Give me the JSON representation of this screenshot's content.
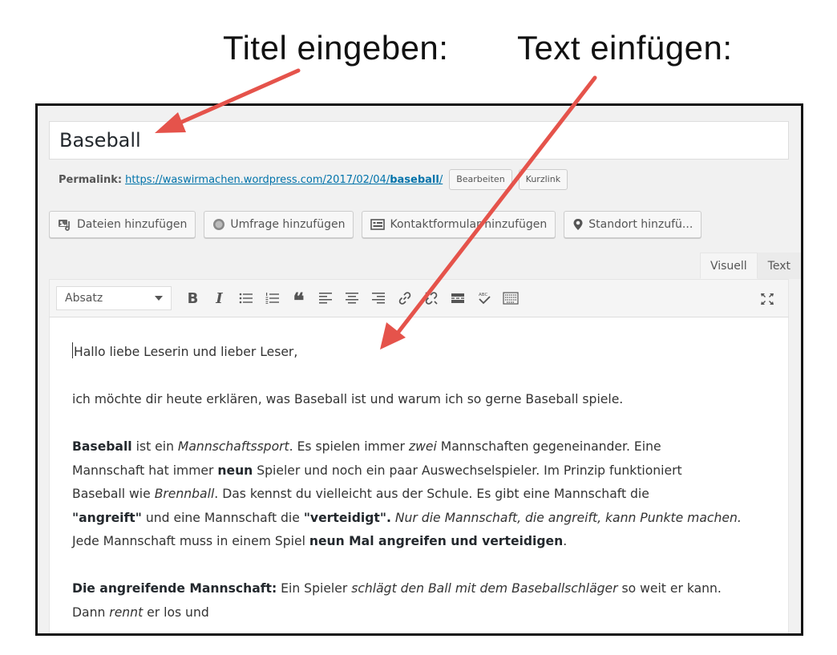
{
  "annotations": {
    "title_hint": "Titel eingeben:",
    "text_hint": "Text einfügen:",
    "arrow_color": "#e5534b"
  },
  "editor": {
    "title_value": "Baseball",
    "permalink": {
      "label": "Permalink:",
      "url_prefix": "https://waswirmachen.wordpress.com/2017/02/04/",
      "url_slug": "baseball",
      "url_suffix": "/",
      "edit_button": "Bearbeiten",
      "shortlink_button": "Kurzlink"
    },
    "media_buttons": {
      "add_files": "Dateien hinzufügen",
      "add_poll": "Umfrage hinzufügen",
      "add_contact_form": "Kontaktformular hinzufügen",
      "add_location": "Standort hinzufü..."
    },
    "mode_tabs": {
      "visual": "Visuell",
      "text": "Text",
      "active": "visual"
    },
    "toolbar": {
      "format_select_value": "Absatz",
      "bold": "B",
      "italic": "I",
      "quote": "❝",
      "icons": [
        "bold-icon",
        "italic-icon",
        "bulleted-list-icon",
        "numbered-list-icon",
        "blockquote-icon",
        "align-left-icon",
        "align-center-icon",
        "align-right-icon",
        "insert-link-icon",
        "remove-link-icon",
        "read-more-icon",
        "spellcheck-icon",
        "toolbar-toggle-icon",
        "fullscreen-icon"
      ]
    },
    "content": {
      "p1": "Hallo liebe Leserin und lieber Leser,",
      "p2": "ich möchte dir heute erklären, was Baseball ist und warum ich so gerne Baseball spiele.",
      "p3": {
        "l1a": "Baseball",
        "l1b": " ist ein ",
        "l1c": "Mannschaftssport",
        "l1d": ". Es spielen immer ",
        "l1e": "zwei",
        "l1f": " Mannschaften gegeneinander. Eine",
        "l2a": "Mannschaft hat immer ",
        "l2b": "neun",
        "l2c": " Spieler und noch ein paar Auswechselspieler. Im Prinzip funktioniert",
        "l3a": "Baseball wie ",
        "l3b": "Brennball",
        "l3c": ". Das kennst du vielleicht aus der Schule. Es gibt eine Mannschaft die",
        "l4a": "\"angreift\"",
        "l4b": " und eine Mannschaft die ",
        "l4c": "\"verteidigt\".",
        "l4d": " Nur die Mannschaft, die angreift, kann Punkte machen.",
        "l5a": "Jede Mannschaft muss in einem Spiel ",
        "l5b": "neun Mal angreifen und verteidigen",
        "l5c": "."
      },
      "p4": {
        "l1a": "Die angreifende Mannschaft:",
        "l1b": " Ein Spieler ",
        "l1c": "schlägt den Ball mit dem Baseballschläger",
        "l1d": " so weit er kann.",
        "l2a": "Dann ",
        "l2b": "rennt",
        "l2c": " er los und"
      }
    },
    "colors": {
      "link": "#0073aa",
      "background": "#f1f1f1"
    }
  }
}
